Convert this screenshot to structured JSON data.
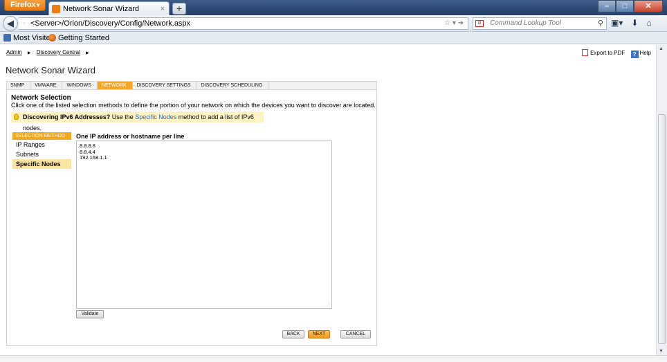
{
  "browser": {
    "app_button": "Firefox",
    "tab_title": "Network Sonar Wizard",
    "new_tab": "+",
    "url": "<Server>/Orion/Discovery/Config/Network.aspx",
    "search_placeholder": "Command Lookup Tool",
    "bookmarks": [
      "Most Visited",
      "Getting Started"
    ]
  },
  "page": {
    "breadcrumb": [
      "Admin",
      "Discovery Central"
    ],
    "export_pdf": "Export to PDF",
    "help": "Help",
    "title": "Network Sonar Wizard"
  },
  "wizard": {
    "steps": [
      "SNMP",
      "VMWARE",
      "WINDOWS",
      "NETWORK",
      "DISCOVERY SETTINGS",
      "DISCOVERY SCHEDULING"
    ],
    "active_step": "NETWORK"
  },
  "network": {
    "section_title": "Network Selection",
    "section_desc": "Click one of the listed selection methods to define the portion of your network on which the devices you want to discover are located.",
    "hint_bold": "Discovering IPv6 Addresses?",
    "hint_pre": " Use the ",
    "hint_link": "Specific Nodes",
    "hint_post": " method to add a list of IPv6 nodes.",
    "method_header": "SELECTION METHOD",
    "methods": [
      "IP Ranges",
      "Subnets",
      "Specific Nodes"
    ],
    "selected_method": "Specific Nodes",
    "ip_label": "One IP address or hostname per line",
    "ip_entries": "8.8.8.8\n8.8.4.4\n192.168.1.1",
    "validate": "Validate",
    "back": "BACK",
    "next": "NEXT",
    "cancel": "CANCEL"
  },
  "colors": {
    "accent": "#f5a623",
    "selected_row": "#fbe3a0",
    "hint_bg": "#fdf3c4",
    "link": "#2c67b1"
  },
  "icons": [
    "firefox-icon",
    "back-arrow-icon",
    "search-engine-icon",
    "bookmark-icon",
    "download-icon",
    "home-icon",
    "pdf-icon",
    "help-icon",
    "bulb-icon"
  ]
}
